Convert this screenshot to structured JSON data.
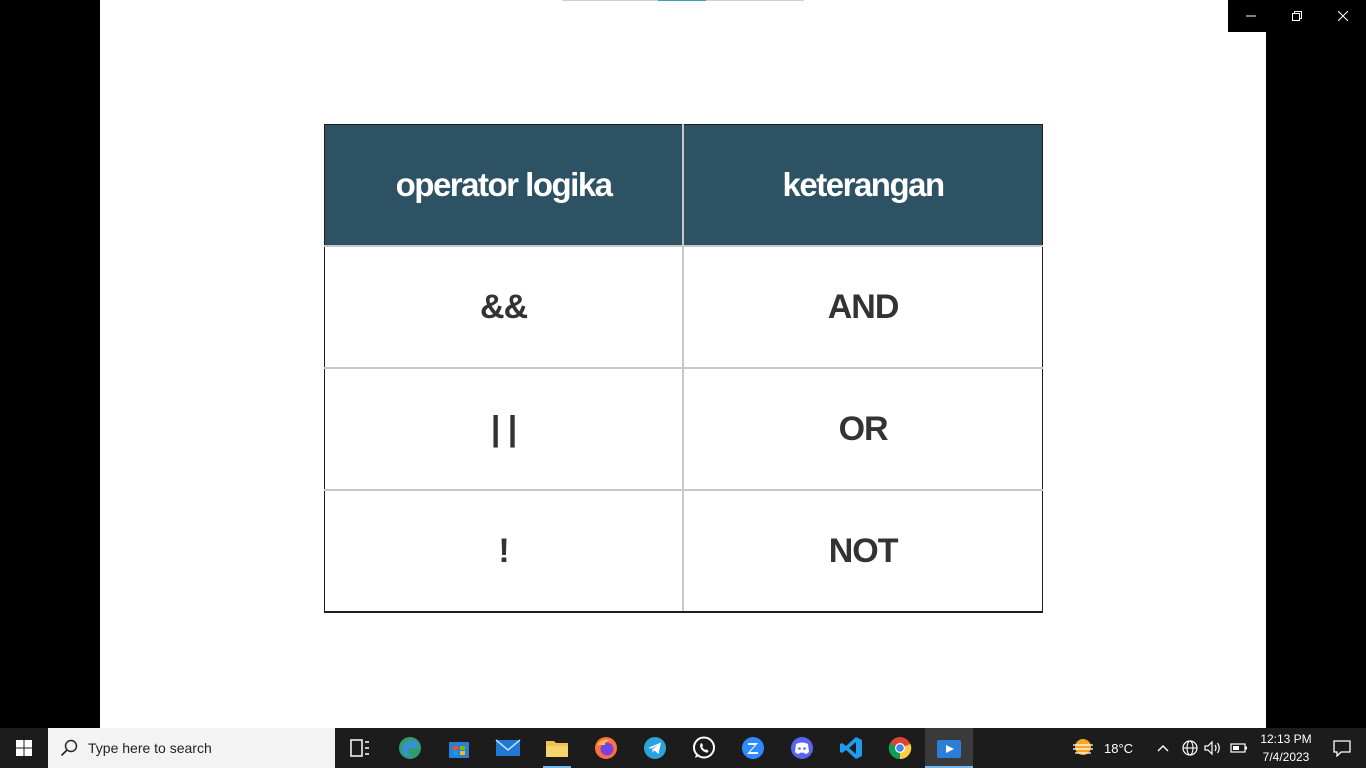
{
  "slide": {
    "table": {
      "headers": [
        "operator logika",
        "keterangan"
      ],
      "rows": [
        {
          "operator": "&&",
          "description": "AND"
        },
        {
          "operator": "| |",
          "description": "OR"
        },
        {
          "operator": "!",
          "description": "NOT"
        }
      ]
    }
  },
  "window_controls": {
    "minimize": "—",
    "restore": "❐",
    "close": "✕"
  },
  "taskbar": {
    "search_placeholder": "Type here to search",
    "pinned_apps": [
      "task-view",
      "edge",
      "microsoft-store",
      "mail",
      "file-explorer",
      "firefox",
      "telegram",
      "whatsapp",
      "zoom",
      "discord",
      "vscode",
      "chrome",
      "media-player"
    ],
    "weather": {
      "temperature": "18°C"
    },
    "clock": {
      "time": "12:13 PM",
      "date": "7/4/2023"
    }
  },
  "colors": {
    "header_bg": "#2d5263",
    "taskbar_bg": "#1c1c1c",
    "accent": "#76b9ed"
  }
}
